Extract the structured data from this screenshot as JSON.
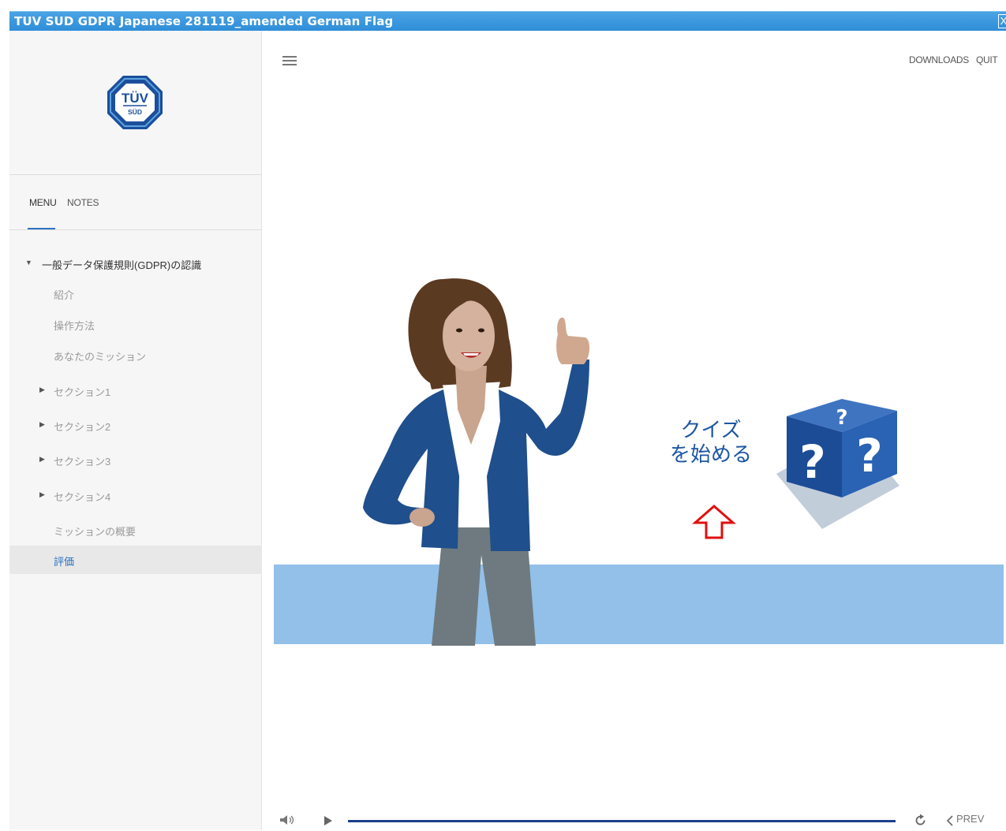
{
  "window": {
    "title": "TUV SUD GDPR Japanese 281119_amended German Flag",
    "close_label": "X"
  },
  "sidebar": {
    "logo": {
      "top": "TÜV",
      "bottom": "SÜD"
    },
    "tabs": {
      "menu": "MENU",
      "notes": "NOTES"
    },
    "items": [
      {
        "label": "一般データ保護規則(GDPR)の認識",
        "caret": "▼",
        "level": 0
      },
      {
        "label": "紹介",
        "level": 1
      },
      {
        "label": "操作方法",
        "level": 1
      },
      {
        "label": "あなたのミッション",
        "level": 1
      },
      {
        "label": "セクション1",
        "caret": "▶",
        "level": 1
      },
      {
        "label": "セクション2",
        "caret": "▶",
        "level": 1
      },
      {
        "label": "セクション3",
        "caret": "▶",
        "level": 1
      },
      {
        "label": "セクション4",
        "caret": "▶",
        "level": 1
      },
      {
        "label": "ミッションの概要",
        "level": 1
      },
      {
        "label": "評価",
        "level": 1,
        "active": true
      }
    ]
  },
  "header": {
    "downloads": "DOWNLOADS",
    "quit": "QUIT"
  },
  "slide": {
    "quiz_line1": "クイズ",
    "quiz_line2": "を始める",
    "cube_marks": "?"
  },
  "player": {
    "prev": "PREV"
  },
  "colors": {
    "titlebar": "#3a98de",
    "accent": "#2b72c2",
    "floor": "#92c0e8",
    "quiz_text": "#1d56a3",
    "arrow": "#e01010",
    "cube": "#2a5ca8"
  }
}
